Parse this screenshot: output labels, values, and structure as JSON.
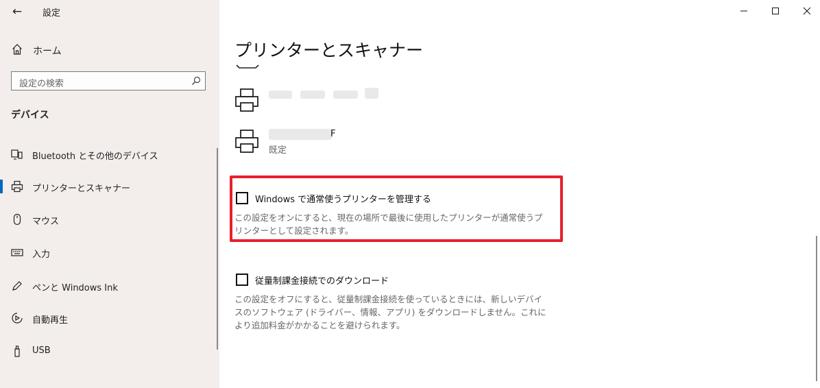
{
  "app": {
    "title": "設定"
  },
  "sidebar": {
    "home_label": "ホーム",
    "search_placeholder": "設定の検索",
    "section_title": "デバイス",
    "items": [
      {
        "label": "Bluetooth とその他のデバイス",
        "icon": "bluetooth-devices-icon"
      },
      {
        "label": "プリンターとスキャナー",
        "icon": "printer-icon",
        "selected": true
      },
      {
        "label": "マウス",
        "icon": "mouse-icon"
      },
      {
        "label": "入力",
        "icon": "keyboard-icon"
      },
      {
        "label": "ペンと Windows Ink",
        "icon": "pen-icon"
      },
      {
        "label": "自動再生",
        "icon": "autoplay-icon"
      },
      {
        "label": "USB",
        "icon": "usb-icon"
      }
    ]
  },
  "main": {
    "title": "プリンターとスキャナー",
    "printers": [
      {
        "name": "",
        "status": ""
      },
      {
        "name": "F",
        "status": "既定"
      }
    ],
    "options": [
      {
        "label": "Windows で通常使うプリンターを管理する",
        "description": "この設定をオンにすると、現在の場所で最後に使用したプリンターが通常使うプリンターとして設定されます。",
        "checked": false
      },
      {
        "label": "従量制課金接続でのダウンロード",
        "description": "この設定をオフにすると、従量制課金接続を使っているときには、新しいデバイスのソフトウェア (ドライバー、情報、アプリ) をダウンロードしません。これにより追加料金がかかることを避けられます。",
        "checked": false
      }
    ]
  },
  "colors": {
    "accent": "#0067c0",
    "highlight": "#e81e2c",
    "sidebar_bg": "#f3eeec"
  }
}
